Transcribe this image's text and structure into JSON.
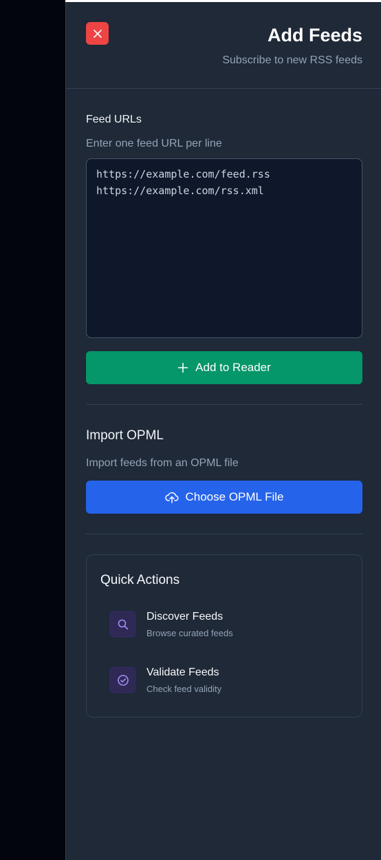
{
  "header": {
    "title": "Add Feeds",
    "subtitle": "Subscribe to new RSS feeds"
  },
  "feed_urls": {
    "label": "Feed URLs",
    "hint": "Enter one feed URL per line",
    "value": "https://example.com/feed.rss\nhttps://example.com/rss.xml",
    "add_button_label": "Add to Reader"
  },
  "import_opml": {
    "title": "Import OPML",
    "hint": "Import feeds from an OPML file",
    "button_label": "Choose OPML File"
  },
  "quick_actions": {
    "title": "Quick Actions",
    "items": [
      {
        "name": "Discover Feeds",
        "description": "Browse curated feeds",
        "icon": "search-icon"
      },
      {
        "name": "Validate Feeds",
        "description": "Check feed validity",
        "icon": "check-circle-icon"
      }
    ]
  },
  "colors": {
    "panel_bg": "#1f2937",
    "close_red": "#ef4444",
    "add_green": "#059669",
    "opml_blue": "#2563eb",
    "icon_purple": "#a78bfa"
  }
}
